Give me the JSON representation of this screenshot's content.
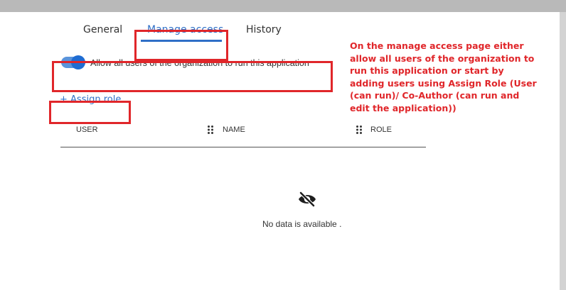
{
  "tabs": [
    {
      "label": "General"
    },
    {
      "label": "Manage access",
      "active": true
    },
    {
      "label": "History"
    }
  ],
  "access": {
    "allow_all_label": "Allow all users of the organization to run this application",
    "allow_all_enabled": true,
    "assign_role_label": "+ Assign role"
  },
  "table": {
    "columns": [
      "USER",
      "NAME",
      "ROLE"
    ],
    "empty_text": "No data is available ."
  },
  "annotation": {
    "lines": [
      "On the manage access page either",
      "allow all users of the organization to",
      "run this application or start by",
      "adding users using Assign Role (User",
      "(can run)/ Co-Author (can run and",
      "edit the application))"
    ]
  },
  "icons": {
    "drag_handle": "grip-icon",
    "empty_state": "eye-slash-icon"
  },
  "colors": {
    "accent": "#2f6fc7",
    "highlight": "#e0262a"
  }
}
